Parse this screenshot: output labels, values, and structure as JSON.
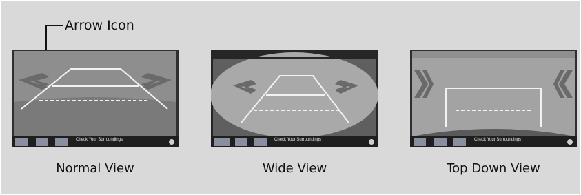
{
  "callout": {
    "label": "Arrow Icon"
  },
  "views": [
    {
      "caption": "Normal View",
      "bar_text": "Check Your Surroundings"
    },
    {
      "caption": "Wide View",
      "bar_text": "Check Your Surroundings"
    },
    {
      "caption": "Top Down View",
      "bar_text": "Check Your Surroundings"
    }
  ],
  "icons": {
    "view_buttons": [
      "normal-view-icon",
      "wide-view-icon",
      "top-down-view-icon"
    ],
    "settings": "camera-settings-icon",
    "arrow": "guide-arrow-icon"
  }
}
